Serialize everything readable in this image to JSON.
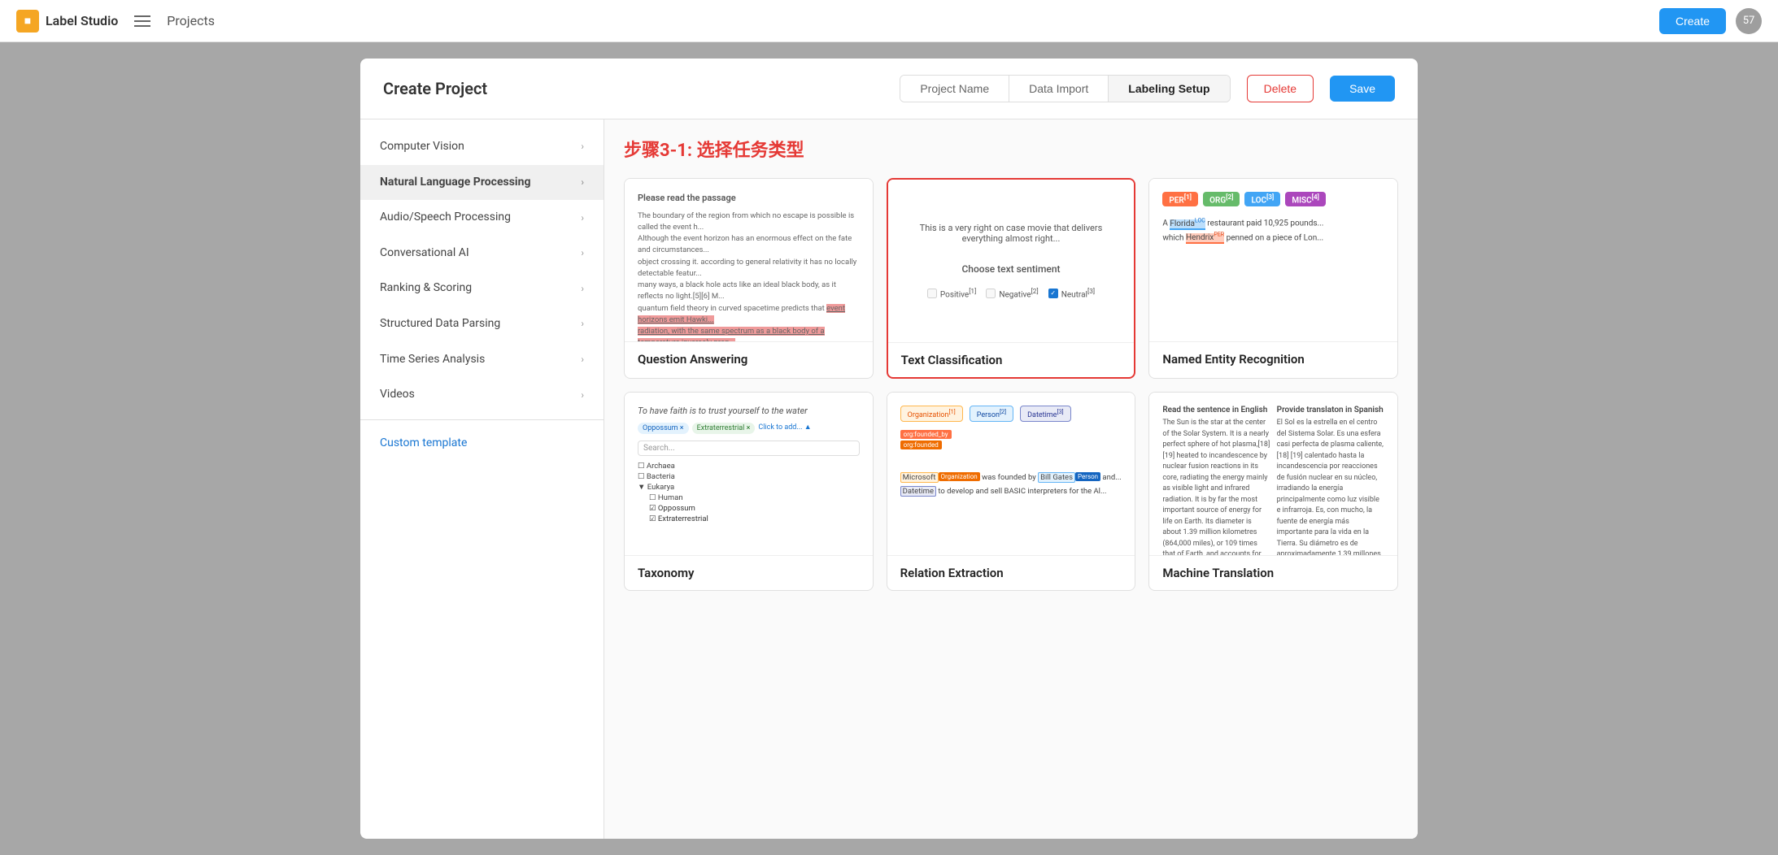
{
  "topbar": {
    "logo_text": "Label Studio",
    "nav_title": "Projects",
    "create_label": "Create",
    "avatar_count": "57"
  },
  "modal": {
    "title": "Create Project",
    "tabs": [
      {
        "id": "project-name",
        "label": "Project Name",
        "active": false
      },
      {
        "id": "data-import",
        "label": "Data Import",
        "active": false
      },
      {
        "id": "labeling-setup",
        "label": "Labeling Setup",
        "active": true
      }
    ],
    "delete_label": "Delete",
    "save_label": "Save"
  },
  "sidebar": {
    "items": [
      {
        "id": "computer-vision",
        "label": "Computer Vision",
        "active": false
      },
      {
        "id": "nlp",
        "label": "Natural Language Processing",
        "active": true
      },
      {
        "id": "audio-speech",
        "label": "Audio/Speech Processing",
        "active": false
      },
      {
        "id": "conversational-ai",
        "label": "Conversational AI",
        "active": false
      },
      {
        "id": "ranking-scoring",
        "label": "Ranking & Scoring",
        "active": false
      },
      {
        "id": "structured-data",
        "label": "Structured Data Parsing",
        "active": false
      },
      {
        "id": "time-series",
        "label": "Time Series Analysis",
        "active": false
      },
      {
        "id": "videos",
        "label": "Videos",
        "active": false
      }
    ],
    "custom_template_label": "Custom template"
  },
  "step_indicator": "步骤3-1: 选择任务类型",
  "cards": [
    {
      "id": "question-answering",
      "label": "Question Answering",
      "selected": false
    },
    {
      "id": "text-classification",
      "label": "Text Classification",
      "selected": true
    },
    {
      "id": "named-entity-recognition",
      "label": "Named Entity Recognition",
      "selected": false
    },
    {
      "id": "taxonomy",
      "label": "Taxonomy",
      "selected": false
    },
    {
      "id": "relation-extraction",
      "label": "Relation Extraction",
      "selected": false
    },
    {
      "id": "machine-translation",
      "label": "Machine Translation",
      "selected": false
    }
  ]
}
